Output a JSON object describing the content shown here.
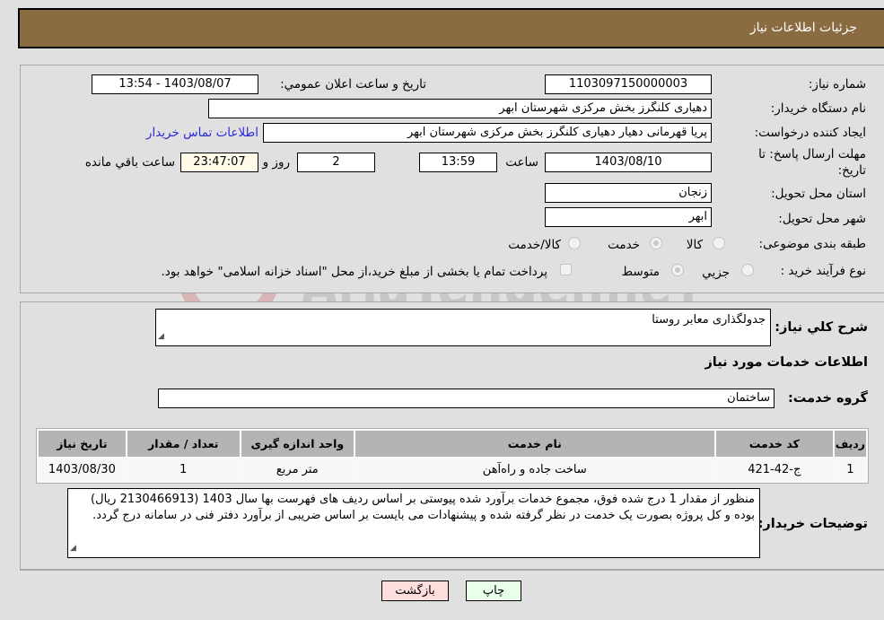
{
  "header": {
    "title": "جزئیات اطلاعات نیاز"
  },
  "form": {
    "need_number_label": "شماره نیاز:",
    "need_number": "1103097150000003",
    "announce_label": "تاریخ و ساعت اعلان عمومي:",
    "announce_value": "1403/08/07 - 13:54",
    "buyer_org_label": "نام دستگاه خریدار:",
    "buyer_org": "دهیاری کلنگرز بخش مرکزی شهرستان ابهر",
    "creator_label": "ایجاد کننده درخواست:",
    "creator": "پریا قهرمانی دهیار دهیاری کلنگرز بخش مرکزی شهرستان ابهر",
    "contact_link": "اطلاعات تماس خریدار",
    "deadline_label_1": "مهلت ارسال پاسخ: تا",
    "deadline_label_2": "تاریخ:",
    "deadline_date": "1403/08/10",
    "time_label": "ساعت",
    "deadline_time": "13:59",
    "days_value": "2",
    "days_label": "روز و",
    "remaining_time": "23:47:07",
    "remaining_label": "ساعت باقي مانده",
    "province_label": "استان محل تحویل:",
    "province": "زنجان",
    "city_label": "شهر محل تحویل:",
    "city": "ابهر",
    "category_label": "طبقه بندی موضوعی:",
    "category_options": [
      {
        "label": "کالا",
        "selected": false
      },
      {
        "label": "خدمت",
        "selected": true
      },
      {
        "label": "کالا/خدمت",
        "selected": false
      }
    ],
    "process_label": "نوع فرآیند خرید :",
    "process_options": [
      {
        "label": "جزیي",
        "selected": false
      },
      {
        "label": "متوسط",
        "selected": true
      }
    ],
    "treasury_checkbox_checked": false,
    "treasury_note": "پرداخت تمام یا بخشی از مبلغ خرید،از محل \"اسناد خزانه اسلامی\" خواهد بود."
  },
  "details": {
    "summary_label": "شرح کلي نیاز:",
    "summary": "جدولگذاری معابر روستا",
    "services_heading": "اطلاعات خدمات مورد نیاز",
    "service_group_label": "گروه خدمت:",
    "service_group": "ساختمان",
    "table": {
      "headers": [
        "ردیف",
        "کد خدمت",
        "نام خدمت",
        "واحد اندازه گیری",
        "تعداد / مقدار",
        "تاریخ نیاز"
      ],
      "rows": [
        [
          "1",
          "ج-42-421",
          "ساخت جاده و راه‌آهن",
          "متر مربع",
          "1",
          "1403/08/30"
        ]
      ]
    },
    "buyer_notes_label": "توضیحات خریدار:",
    "buyer_notes": "منظور از مقدار 1 درج شده فوق، مجموع خدمات برآورد شده پیوستی بر اساس ردیف های فهرست بها سال 1403 (2130466913 ریال) بوده و کل پروژه بصورت یک خدمت در نظر گرفته شده و پیشنهادات می بایست بر اساس ضریبی از برآورد دفتر فنی در سامانه درج گردد."
  },
  "buttons": {
    "print": "چاپ",
    "back": "بازگشت"
  },
  "colors": {
    "header": "#8b6c42",
    "print_bg": "#eaffea",
    "back_bg": "#ffdede",
    "link": "#2a2ad8"
  },
  "watermark": {
    "text": "AriaTender.neT"
  }
}
